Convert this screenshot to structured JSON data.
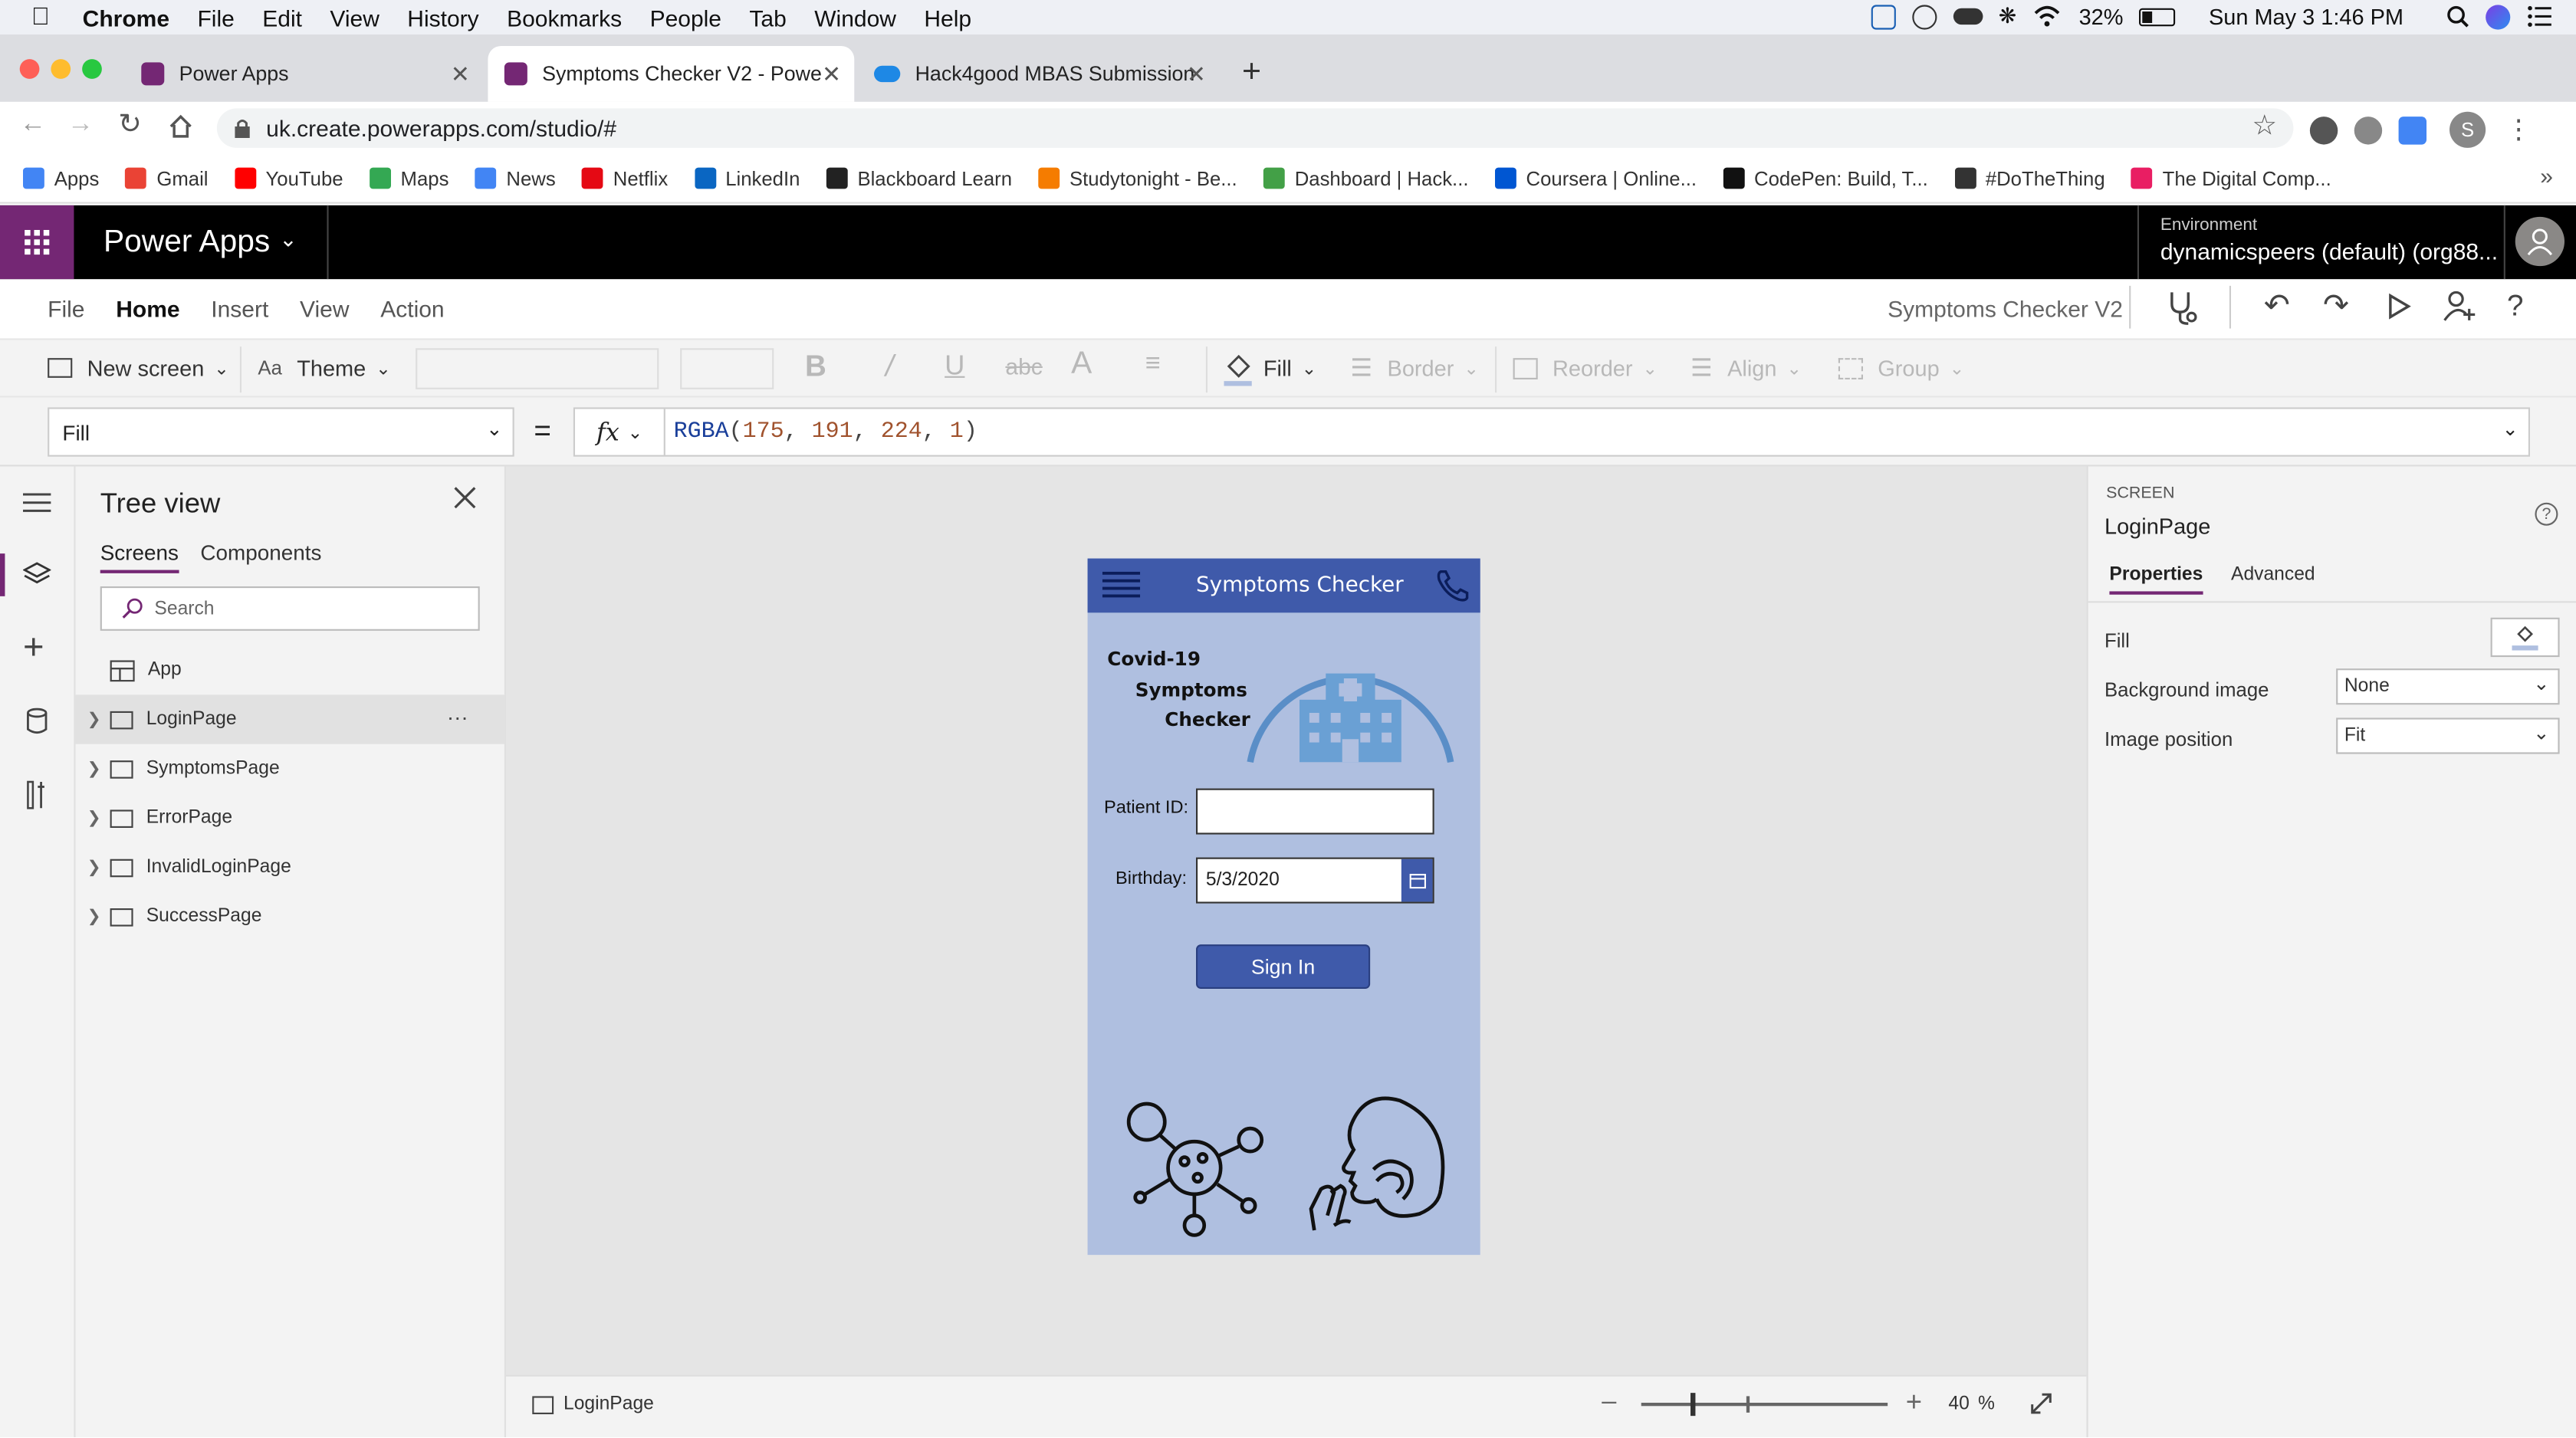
{
  "menubar": {
    "app": "Chrome",
    "items": [
      "File",
      "Edit",
      "View",
      "History",
      "Bookmarks",
      "People",
      "Tab",
      "Window",
      "Help"
    ],
    "battery": "32%",
    "datetime": "Sun May 3  1:46 PM"
  },
  "tabs": [
    {
      "title": "Power Apps"
    },
    {
      "title": "Symptoms Checker V2 - Powe"
    },
    {
      "title": "Hack4good MBAS Submission"
    }
  ],
  "address": {
    "url": "uk.create.powerapps.com/studio/#",
    "profile_initial": "S"
  },
  "bookmarks": [
    {
      "label": "Apps",
      "color": "#4285f4"
    },
    {
      "label": "Gmail",
      "color": "#ea4335"
    },
    {
      "label": "YouTube",
      "color": "#ff0000"
    },
    {
      "label": "Maps",
      "color": "#34a853"
    },
    {
      "label": "News",
      "color": "#4285f4"
    },
    {
      "label": "Netflix",
      "color": "#e50914"
    },
    {
      "label": "LinkedIn",
      "color": "#0a66c2"
    },
    {
      "label": "Blackboard Learn",
      "color": "#222222"
    },
    {
      "label": "Studytonight - Be...",
      "color": "#f57c00"
    },
    {
      "label": "Dashboard | Hack...",
      "color": "#43a047"
    },
    {
      "label": "Coursera | Online...",
      "color": "#0056d2"
    },
    {
      "label": "CodePen: Build, T...",
      "color": "#111111"
    },
    {
      "label": "#DoTheThing",
      "color": "#333333"
    },
    {
      "label": "The Digital Comp...",
      "color": "#e91e63"
    }
  ],
  "header": {
    "product": "Power Apps",
    "environment_label": "Environment",
    "environment_value": "dynamicspeers (default) (org88..."
  },
  "ribbon": {
    "tabs": [
      "File",
      "Home",
      "Insert",
      "View",
      "Action"
    ],
    "active_tab": "Home",
    "app_name": "Symptoms Checker V2"
  },
  "toolbar": {
    "new_screen": "New screen",
    "theme": "Theme",
    "fill": "Fill",
    "border": "Border",
    "reorder": "Reorder",
    "align": "Align",
    "group": "Group"
  },
  "formula": {
    "property": "Fill",
    "equals": "=",
    "fx": "fx",
    "fn": "RGBA",
    "args": [
      "175",
      "191",
      "224",
      "1"
    ]
  },
  "tree": {
    "title": "Tree view",
    "tabs": [
      "Screens",
      "Components"
    ],
    "search_placeholder": "Search",
    "app": "App",
    "screens": [
      "LoginPage",
      "SymptomsPage",
      "ErrorPage",
      "InvalidLoginPage",
      "SuccessPage"
    ],
    "selected": "LoginPage",
    "more": "···"
  },
  "phone": {
    "title": "Symptoms Checker",
    "heading": [
      "Covid-19",
      "Symptoms",
      "Checker"
    ],
    "patient_label": "Patient ID:",
    "patient_value": "",
    "birthday_label": "Birthday:",
    "birthday_value": "5/3/2020",
    "sign_in": "Sign In",
    "bg_color": "#afbfe0",
    "header_color": "#3f5aaa"
  },
  "bottombar": {
    "screen": "LoginPage",
    "zoom": "40",
    "zoom_unit": "%",
    "zoom_fraction": 0.4
  },
  "props": {
    "type": "SCREEN",
    "name": "LoginPage",
    "tabs": [
      "Properties",
      "Advanced"
    ],
    "fill_label": "Fill",
    "bg_image_label": "Background image",
    "bg_image_value": "None",
    "image_pos_label": "Image position",
    "image_pos_value": "Fit"
  }
}
